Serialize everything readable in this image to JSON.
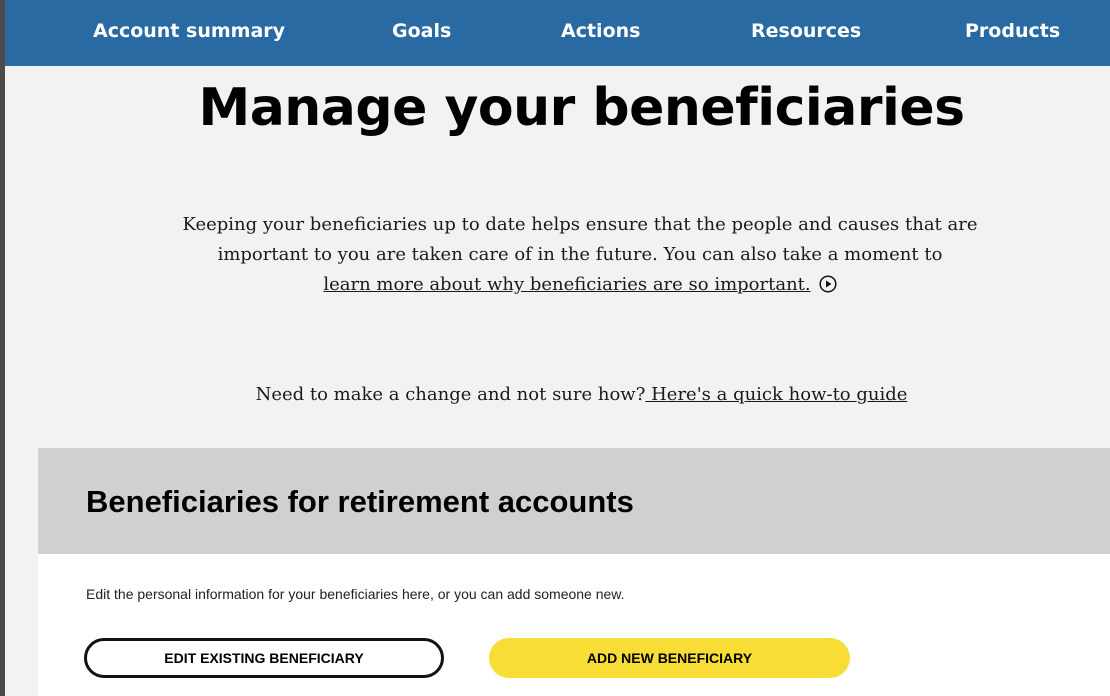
{
  "nav": {
    "items": [
      {
        "label": "Account summary"
      },
      {
        "label": "Goals"
      },
      {
        "label": "Actions"
      },
      {
        "label": "Resources"
      },
      {
        "label": "Products"
      }
    ]
  },
  "page": {
    "title": "Manage your beneficiaries"
  },
  "intro": {
    "text": "Keeping your beneficiaries up to date helps ensure that the people and causes that are important to you are taken care of in the future. You can also take a moment to",
    "link_label": "learn more about why beneficiaries are so important.",
    "link_icon": "play-circle-icon"
  },
  "howto": {
    "text": "Need to make a change and not sure how?",
    "link_label": " Here's a quick how-to guide"
  },
  "retirement_section": {
    "title": "Beneficiaries for retirement accounts",
    "description": "Edit the personal information for your beneficiaries here, or you can add someone new.",
    "edit_button_label": "EDIT EXISTING BENEFICIARY",
    "add_button_label": "ADD NEW BENEFICIARY"
  },
  "colors": {
    "nav_background": "#2a6aa3",
    "add_button": "#f7dd35",
    "section_band": "#d0d0d0"
  }
}
